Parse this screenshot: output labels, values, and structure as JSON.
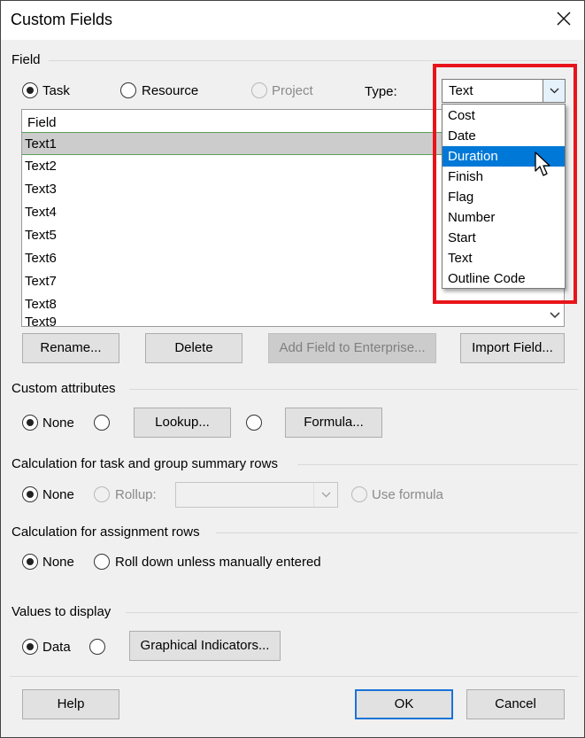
{
  "window": {
    "title": "Custom Fields"
  },
  "field_section": {
    "label": "Field",
    "radios": {
      "task": "Task",
      "resource": "Resource",
      "project": "Project"
    },
    "type_label": "Type:",
    "type_value": "Text"
  },
  "field_list": {
    "header": "Field",
    "rows": [
      "Text1",
      "Text2",
      "Text3",
      "Text4",
      "Text5",
      "Text6",
      "Text7",
      "Text8"
    ]
  },
  "type_dropdown": {
    "options": [
      "Cost",
      "Date",
      "Duration",
      "Finish",
      "Flag",
      "Number",
      "Start",
      "Text",
      "Outline Code"
    ],
    "highlighted": "Duration"
  },
  "list_buttons": {
    "rename": "Rename...",
    "delete": "Delete",
    "add_enterprise": "Add Field to Enterprise...",
    "import": "Import Field..."
  },
  "custom_attributes": {
    "label": "Custom attributes",
    "none": "None",
    "lookup": "Lookup...",
    "formula": "Formula..."
  },
  "calc_summary": {
    "label": "Calculation for task and group summary rows",
    "none": "None",
    "rollup": "Rollup:",
    "use_formula": "Use formula"
  },
  "calc_assignment": {
    "label": "Calculation for assignment rows",
    "none": "None",
    "roll_down": "Roll down unless manually entered"
  },
  "values_display": {
    "label": "Values to display",
    "data": "Data",
    "graphical": "Graphical Indicators..."
  },
  "footer": {
    "help": "Help",
    "ok": "OK",
    "cancel": "Cancel"
  },
  "colors": {
    "highlight": "#0078d7",
    "annotation": "#e8141b",
    "default_button_border": "#1a73d6"
  }
}
